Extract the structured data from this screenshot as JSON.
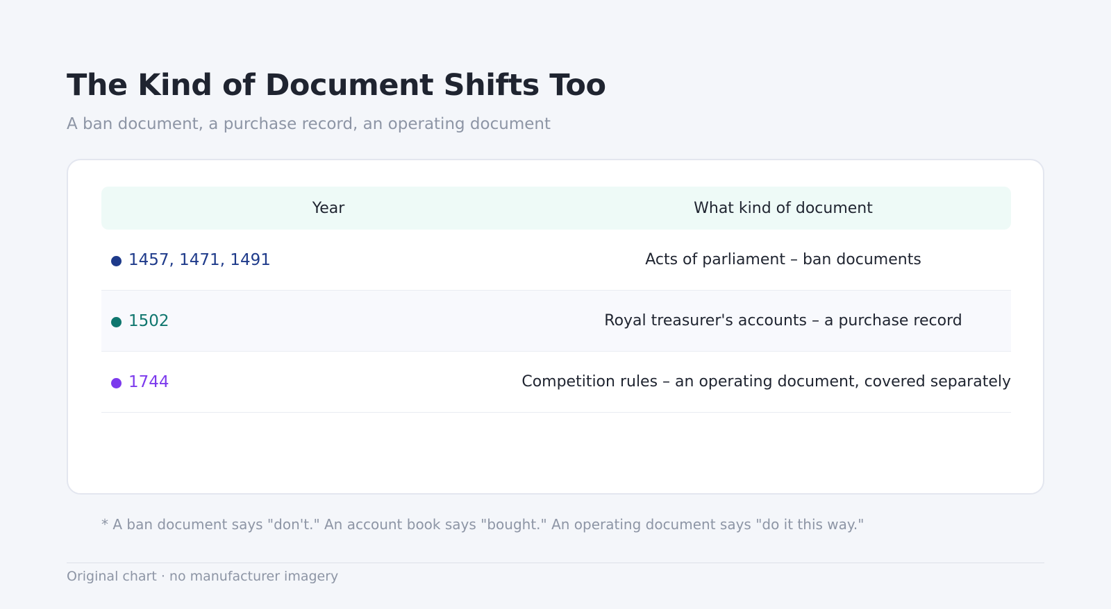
{
  "header": {
    "title": "The Kind of Document Shifts Too",
    "subtitle": "A ban document, a purchase record, an operating document"
  },
  "table": {
    "columns": [
      "Year",
      "What kind of document"
    ],
    "rows": [
      {
        "year": "1457, 1471, 1491",
        "document": "Acts of parliament – ban documents",
        "color": "#1e3a8a"
      },
      {
        "year": "1502",
        "document": "Royal treasurer's accounts – a purchase record",
        "color": "#0f766e"
      },
      {
        "year": "1744",
        "document": "Competition rules – an operating document, covered separately",
        "color": "#7c3aed"
      }
    ]
  },
  "note": "* A ban document says \"don't.\" An account book says \"bought.\" An operating document says \"do it this way.\"",
  "footer": "Original chart · no manufacturer imagery"
}
